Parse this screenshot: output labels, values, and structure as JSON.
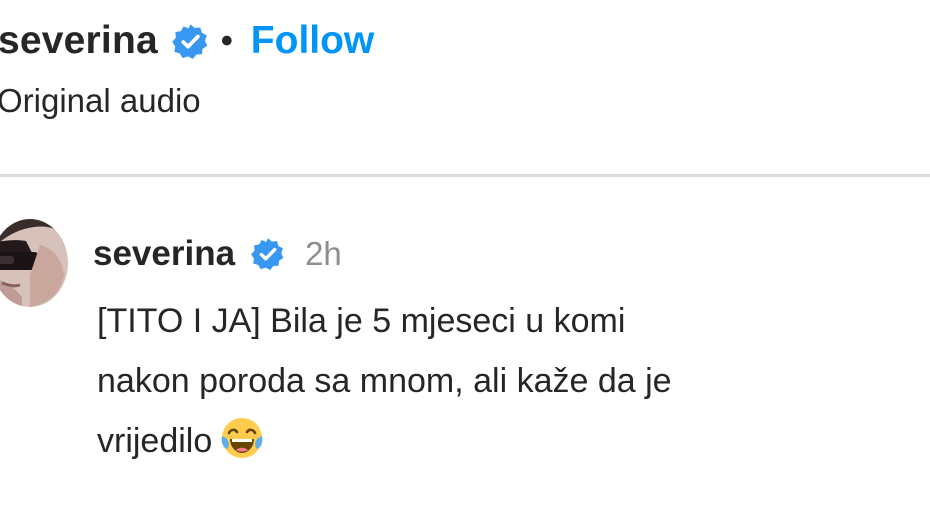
{
  "post_header": {
    "username": "severina",
    "separator": "•",
    "follow_label": "Follow",
    "audio_label": "Original audio"
  },
  "comment": {
    "username": "severina",
    "timestamp": "2h",
    "lines": [
      "[TITO I JA] Bila je 5 mjeseci u komi",
      "nakon poroda sa mnom, ali kaže da je",
      "vrijedilo"
    ],
    "emoji": "face-with-tears-of-joy"
  },
  "colors": {
    "text": "#262626",
    "secondary_text": "#8e8e8e",
    "follow_blue": "#0095f6",
    "verified_blue": "#3897f0",
    "divider": "#dbdbdb"
  },
  "icons": {
    "verified": "verified-badge-icon",
    "avatar": "profile-avatar"
  }
}
